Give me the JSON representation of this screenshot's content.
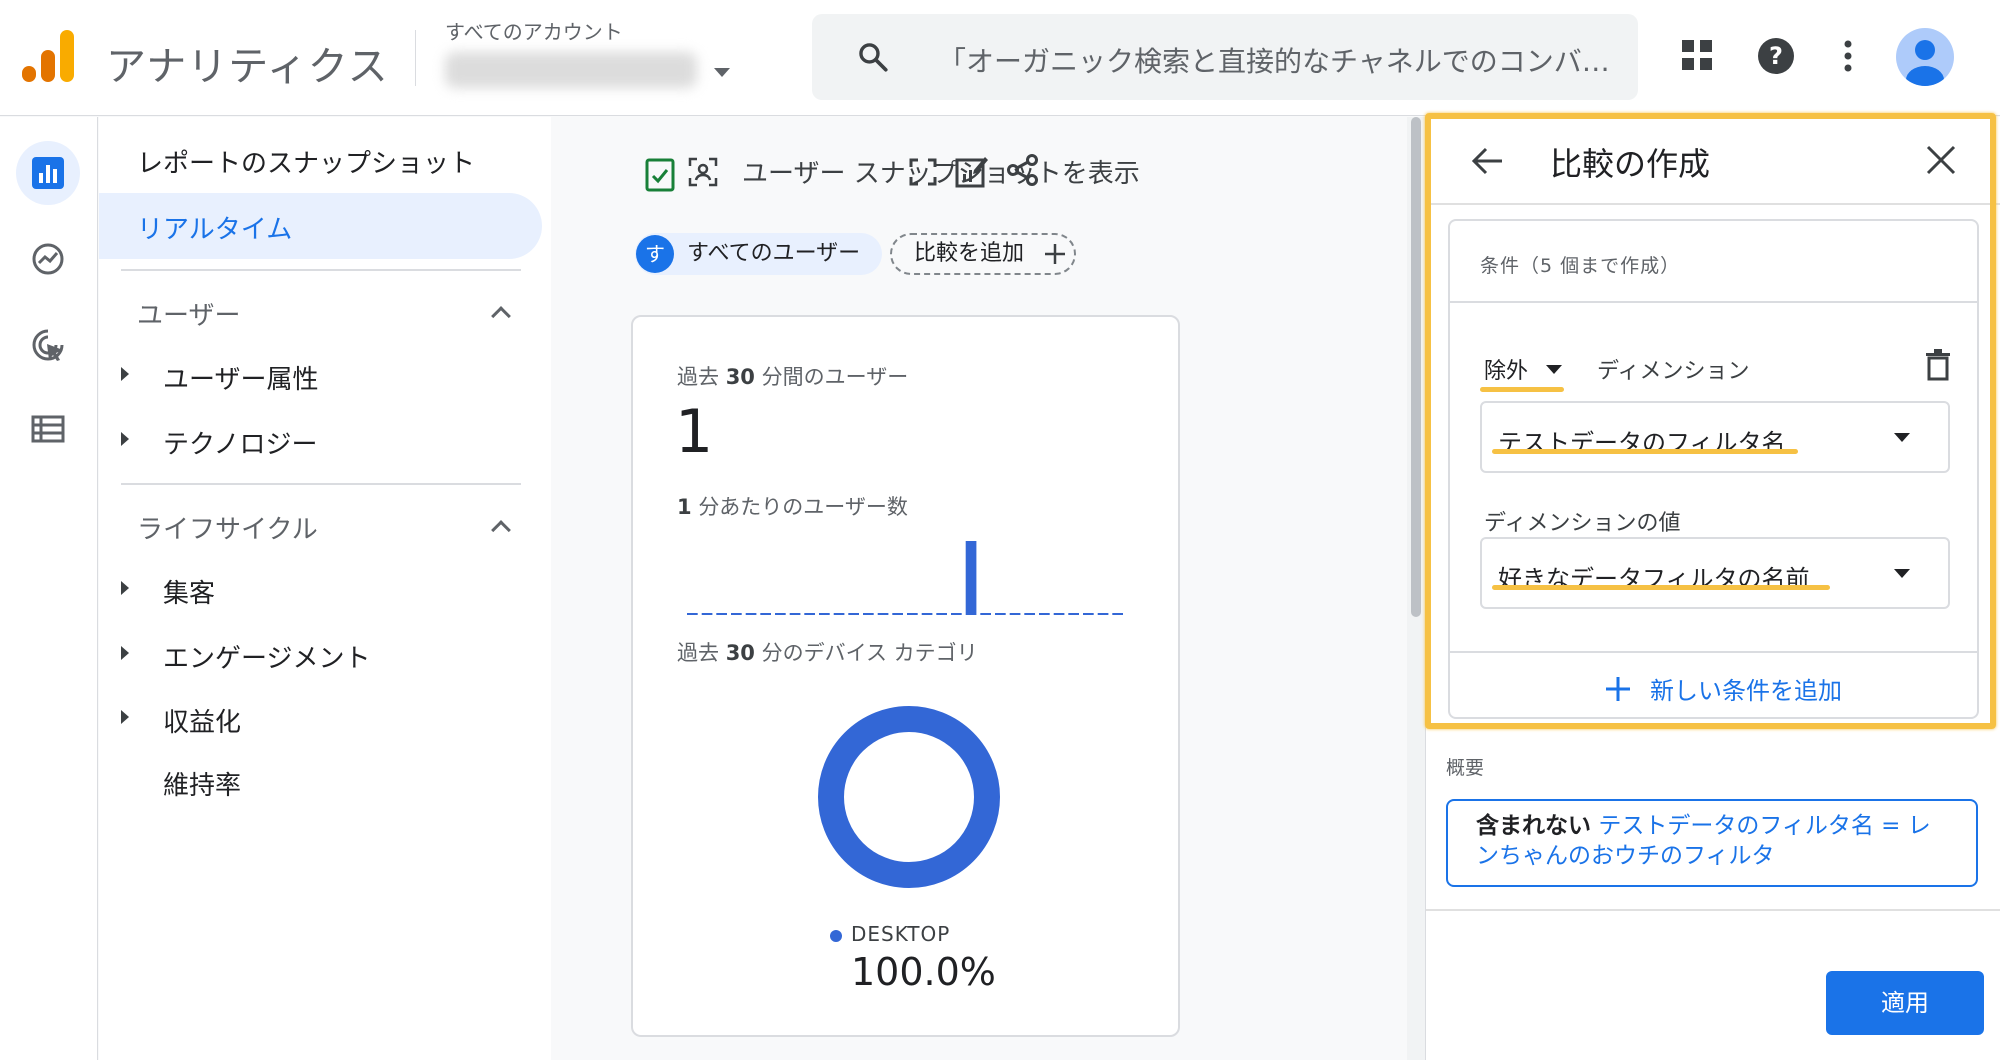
{
  "header": {
    "app_title": "アナリティクス",
    "account_label": "すべてのアカウント",
    "search_placeholder": "「オーガニック検索と直接的なチャネルでのコンバ…",
    "icons": [
      "apps-grid-icon",
      "help-icon",
      "more-vert-icon",
      "account-avatar-icon"
    ]
  },
  "rail": {
    "items": [
      "reports-icon",
      "explore-icon",
      "advertising-icon",
      "configure-icon"
    ]
  },
  "nav": {
    "top_item": "レポートのスナップショット",
    "active_item": "リアルタイム",
    "section_users": "ユーザー",
    "users_items": [
      "ユーザー属性",
      "テクノロジー"
    ],
    "section_lifecycle": "ライフサイクル",
    "lifecycle_items": [
      "集客",
      "エンゲージメント",
      "収益化",
      "維持率"
    ]
  },
  "toolbar": {
    "snapshot_label": "ユーザー スナップショットを表示"
  },
  "chips": {
    "avatar_letter": "す",
    "all_users": "すべてのユーザー",
    "add_compare": "比較を追加"
  },
  "card": {
    "users_label_pre": "過去",
    "users_label_num": "30",
    "users_label_post": "分間のユーザー",
    "users_value": "1",
    "per_min_num": "1",
    "per_min_label": "分あたりのユーザー数",
    "device_label_pre": "過去",
    "device_label_num": "30",
    "device_label_post": "分のデバイス カテゴリ",
    "device_name": "DESKTOP",
    "device_pct": "100.0%",
    "per_minute_values": [
      0,
      0,
      0,
      0,
      0,
      0,
      0,
      0,
      0,
      0,
      0,
      0,
      0,
      0,
      0,
      0,
      0,
      0,
      0,
      1,
      0,
      0,
      0,
      0,
      0,
      0,
      0,
      0,
      0,
      0
    ],
    "accent_color": "#3367d6"
  },
  "panel": {
    "title": "比較の作成",
    "cond_header": "条件（5 個まで作成）",
    "exclude_label": "除外",
    "dimension_label": "ディメンション",
    "dimension_value": "テストデータのフィルタ名",
    "dim_value_label": "ディメンションの値",
    "dim_value_value": "好きなデータフィルタの名前",
    "add_condition": "新しい条件を追加",
    "summary_label": "概要",
    "summary_bold": "含まれない",
    "summary_rest": "テストデータのフィルタ名 = レンちゃんのおウチのフィルタ",
    "apply": "適用",
    "highlight_color": "#f6c144",
    "primary_color": "#1a73e8"
  }
}
